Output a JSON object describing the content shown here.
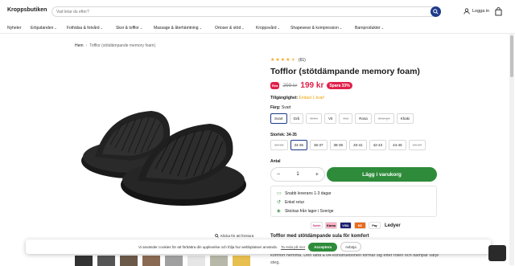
{
  "header": {
    "logo": "Kroppsbutiken",
    "search_placeholder": "Vad letar du efter?",
    "login_label": "Logga in"
  },
  "nav": {
    "items": [
      {
        "label": "Nyheter",
        "caret": false
      },
      {
        "label": "Erbjudanden",
        "caret": true
      },
      {
        "label": "Fothälsa & fotvård",
        "caret": true
      },
      {
        "label": "Skor & tofflor",
        "caret": true
      },
      {
        "label": "Massage & återhämtning",
        "caret": true
      },
      {
        "label": "Ortoser & stöd",
        "caret": true
      },
      {
        "label": "Kroppsvård",
        "caret": true
      },
      {
        "label": "Shapewear & kompression",
        "caret": true
      },
      {
        "label": "Barnprodukter",
        "caret": true
      }
    ]
  },
  "breadcrumb": {
    "home": "Hem",
    "current": "Tofflor (stötdämpande memory foam)"
  },
  "product": {
    "rating": 4.5,
    "rating_count": "(61)",
    "title": "Tofflor (stötdämpande memory foam)",
    "rea_badge": "Rea",
    "old_price": "299 kr",
    "new_price": "199 kr",
    "save_badge": "Spara 33%",
    "availability_label": "Tillgänglighet:",
    "availability_value": "Endast 1 kvar!",
    "color_label": "Färg:",
    "color_selected": "Svart",
    "colors": [
      "Svart",
      "Grå",
      "Grön",
      "Vit",
      "Gul",
      "Rosa",
      "Orange",
      "Khaki"
    ],
    "size_label": "Storlek: 34-35",
    "sizes": [
      "32-33",
      "34-35",
      "36-37",
      "38-39",
      "40-41",
      "42-43",
      "44-45",
      "46-47"
    ],
    "qty_label": "Antal",
    "qty_value": "1",
    "add_to_cart": "Lägg i varukorg",
    "zoom_label": "Klicka för att förstora",
    "usps": [
      "Snabb leverans 1-3 dagar",
      "Enkel retur",
      "Skickas från lager i Sverige"
    ],
    "payments": [
      "Swish",
      "Klarna",
      "VISA",
      "MC",
      "Pay"
    ],
    "ledyer": "Ledyer",
    "desc_title": "Tofflor med stötdämpande sula för komfort",
    "desc_text": "komfort hemma. Den lätta EVA-konstruktionen formar sig efter foten och dämpar varje steg."
  },
  "cookie": {
    "text": "Vi använder cookies för att förbättra din upplevelse och följa hur webbplatsen används.",
    "link": "Ta reda på mer",
    "accept": "Acceptera",
    "decline": "Avböja"
  },
  "colors": {
    "accent_green": "#2e8b3a",
    "sale_red": "#e0204a",
    "nav_blue": "#1e3a8a",
    "star": "#f5a623"
  }
}
